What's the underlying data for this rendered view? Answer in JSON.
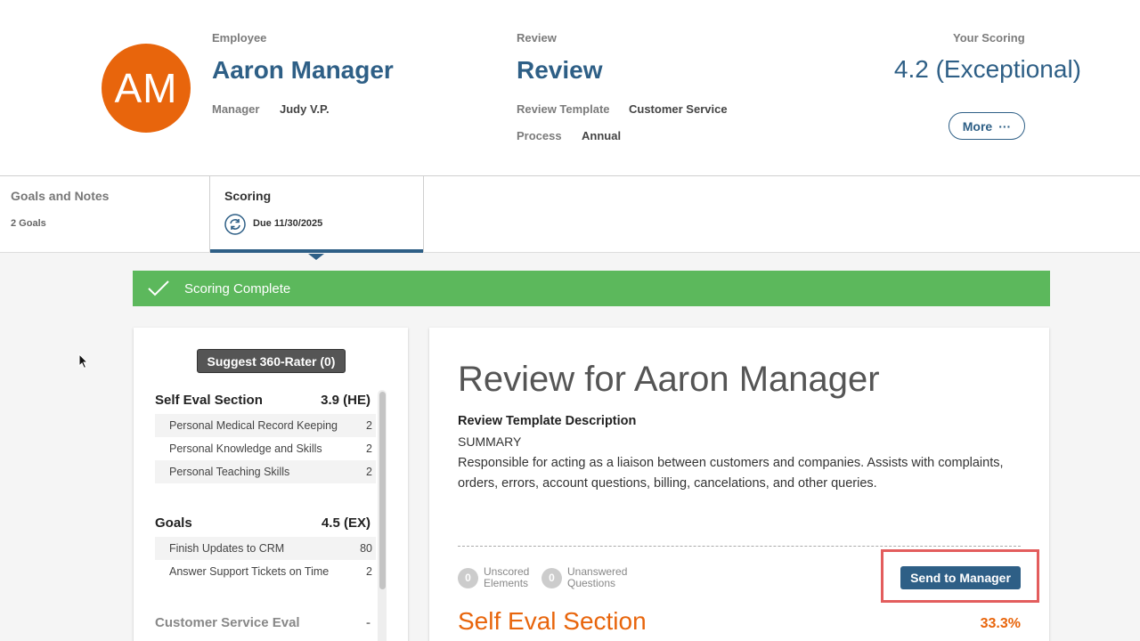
{
  "employee": {
    "label": "Employee",
    "initials": "AM",
    "name": "Aaron Manager",
    "manager_label": "Manager",
    "manager": "Judy V.P."
  },
  "review": {
    "label": "Review",
    "title": "Review",
    "template_label": "Review Template",
    "template": "Customer Service",
    "process_label": "Process",
    "process": "Annual"
  },
  "scoring": {
    "label": "Your Scoring",
    "value": "4.2 (Exceptional)",
    "more_label": "More",
    "more_icon": "···"
  },
  "tabs": [
    {
      "title": "Goals and Notes",
      "sub": "2 Goals"
    },
    {
      "title": "Scoring",
      "sub": "Due 11/30/2025"
    }
  ],
  "banner": {
    "text": "Scoring Complete"
  },
  "sidebar": {
    "suggest_button": "Suggest 360-Rater (0)",
    "sections": [
      {
        "title": "Self Eval Section",
        "score": "3.9 (HE)",
        "items": [
          {
            "label": "Personal Medical Record Keeping",
            "value": "2"
          },
          {
            "label": "Personal Knowledge and Skills",
            "value": "2"
          },
          {
            "label": "Personal Teaching Skills",
            "value": "2"
          }
        ]
      },
      {
        "title": "Goals",
        "score": "4.5 (EX)",
        "items": [
          {
            "label": "Finish Updates to CRM",
            "value": "80"
          },
          {
            "label": "Answer Support Tickets on Time",
            "value": "2"
          }
        ]
      },
      {
        "title": "Customer Service Eval",
        "score": "-",
        "items": []
      }
    ]
  },
  "main": {
    "title": "Review for Aaron Manager",
    "desc_heading": "Review Template Description",
    "summary": "SUMMARY",
    "description": "Responsible for acting as a liaison between customers and companies. Assists with complaints, orders, errors, account questions, billing, cancelations, and other queries.",
    "unscored_count": "0",
    "unscored_label": "Unscored Elements",
    "unanswered_count": "0",
    "unanswered_label": "Unanswered Questions",
    "send_button": "Send to Manager",
    "section_title": "Self Eval Section",
    "section_pct": "33.3%"
  },
  "colors": {
    "brand_blue": "#2e5f86",
    "accent_orange": "#e8650c",
    "success_green": "#5cb85c",
    "highlight_red": "#e35d5d"
  }
}
